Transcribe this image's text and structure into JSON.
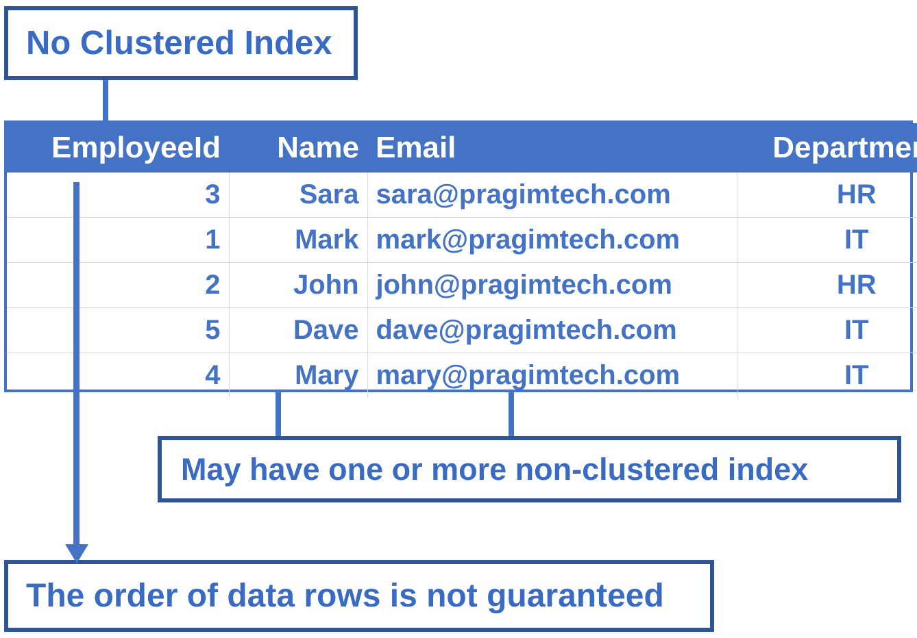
{
  "diagram": {
    "title_box": {
      "label": "No Clustered Index"
    },
    "note_box_middle": {
      "label": "May have one or more non-clustered index"
    },
    "note_box_bottom": {
      "label": "The order of data rows is not guaranteed"
    }
  },
  "table": {
    "columns": [
      {
        "key": "employee_id",
        "header": "EmployeeId",
        "align": "right"
      },
      {
        "key": "name",
        "header": "Name",
        "align": "right"
      },
      {
        "key": "email",
        "header": "Email",
        "align": "left"
      },
      {
        "key": "department",
        "header": "Department",
        "align": "center"
      }
    ],
    "headers": {
      "employee_id": "EmployeeId",
      "name": "Name",
      "email": "Email",
      "department": "Department"
    },
    "rows": [
      {
        "employee_id": "3",
        "name": "Sara",
        "email": "sara@pragimtech.com",
        "department": "HR"
      },
      {
        "employee_id": "1",
        "name": "Mark",
        "email": "mark@pragimtech.com",
        "department": "IT"
      },
      {
        "employee_id": "2",
        "name": "John",
        "email": "john@pragimtech.com",
        "department": "HR"
      },
      {
        "employee_id": "5",
        "name": "Dave",
        "email": "dave@pragimtech.com",
        "department": "IT"
      },
      {
        "employee_id": "4",
        "name": "Mary",
        "email": "mary@pragimtech.com",
        "department": "IT"
      }
    ]
  },
  "colors": {
    "header_fill": "#4472C4",
    "body_text": "#4472C4",
    "box_border": "#2F5597",
    "box_text": "#3A6BC4",
    "grid_line": "#D9D9D9",
    "background": "#FFFFFF"
  }
}
